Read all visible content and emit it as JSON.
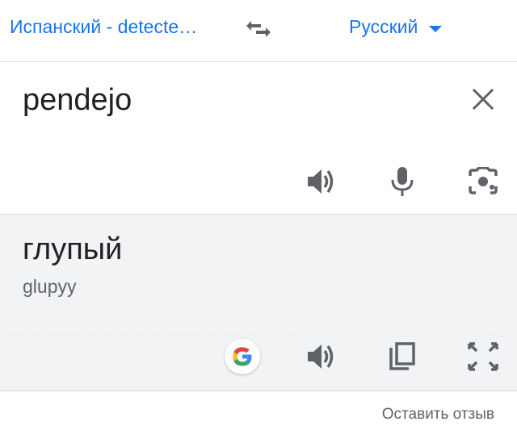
{
  "language_bar": {
    "source_language": "Испанский - detecte…",
    "target_language": "Русский"
  },
  "source": {
    "text": "pendejo"
  },
  "result": {
    "translation": "глупый",
    "transliteration": "glupyy"
  },
  "footer": {
    "feedback_label": "Оставить отзыв"
  },
  "icons": {
    "swap": "swap-languages-icon",
    "dropdown": "chevron-down-icon",
    "clear": "close-icon",
    "listen_source": "speaker-icon",
    "voice_input": "microphone-icon",
    "camera_input": "camera-icon",
    "google": "google-logo-icon",
    "listen_result": "speaker-icon",
    "copy": "copy-icon",
    "fullscreen": "fullscreen-icon"
  },
  "colors": {
    "accent": "#1a73e8",
    "icon": "#5f6368",
    "text": "#202124",
    "result_bg": "#f1f3f4",
    "divider": "#dadce0"
  }
}
